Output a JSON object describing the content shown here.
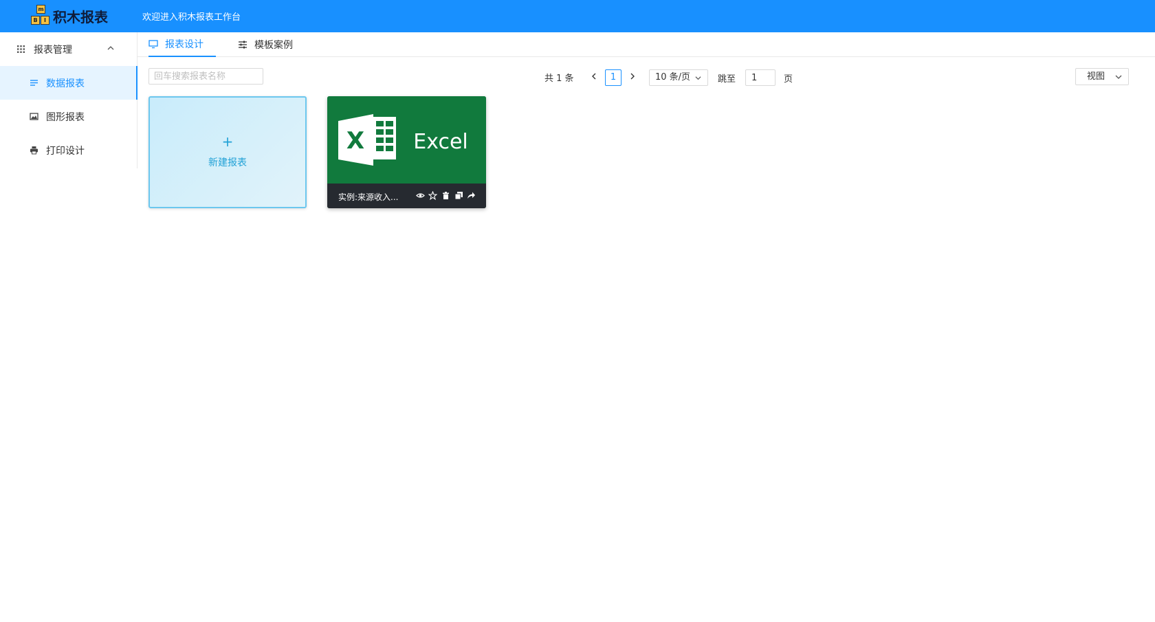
{
  "header": {
    "logo_text": "积木报表",
    "logo_blocks": [
      "m",
      "B",
      "I"
    ],
    "welcome": "欢迎进入积木报表工作台",
    "background_color": "#1890ff"
  },
  "sidebar": {
    "group_label": "报表管理",
    "group_icon": "grid-icon",
    "group_expanded": true,
    "items": [
      {
        "label": "数据报表",
        "icon": "list-icon",
        "active": true
      },
      {
        "label": "图形报表",
        "icon": "image-icon",
        "active": false
      },
      {
        "label": "打印设计",
        "icon": "printer-icon",
        "active": false
      }
    ]
  },
  "tabs": [
    {
      "label": "报表设计",
      "icon": "monitor-icon",
      "active": true
    },
    {
      "label": "模板案例",
      "icon": "sliders-icon",
      "active": false
    }
  ],
  "toolbar": {
    "search_placeholder": "回车搜索报表名称",
    "search_value": ""
  },
  "pagination": {
    "total": "共 1 条",
    "current_page": "1",
    "page_size": "10 条/页",
    "jump_label": "跳至",
    "jump_value": "1",
    "jump_suffix": "页"
  },
  "view_select": {
    "label": "视图"
  },
  "cards": {
    "new_card": {
      "plus": "+",
      "label": "新建报表"
    },
    "reports": [
      {
        "name": "实例:来源收入...",
        "cover_text": "Excel",
        "cover_letter": "X",
        "cover_color": "#117a3d",
        "actions": [
          "eye-icon",
          "star-icon",
          "trash-icon",
          "copy-icon",
          "share-icon"
        ]
      }
    ]
  },
  "colors": {
    "accent": "#1890ff",
    "active_bg": "#e6f4ff",
    "new_card_text": "#21a1d6",
    "excel_green": "#117a3d",
    "card_footer": "#262a30"
  }
}
